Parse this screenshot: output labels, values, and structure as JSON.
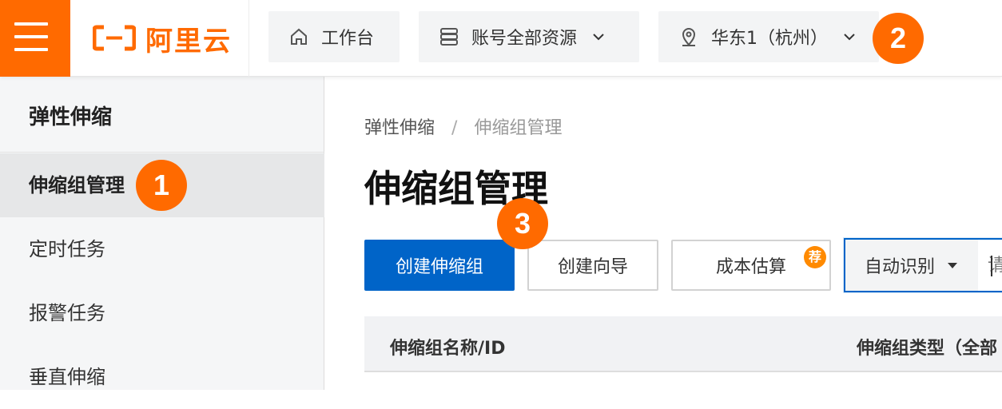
{
  "topbar": {
    "logo_text": "阿里云",
    "home_label": "工作台",
    "resources_label": "账号全部资源",
    "region_label": "华东1（杭州）"
  },
  "steps": [
    "1",
    "2",
    "3"
  ],
  "sidebar": {
    "title": "弹性伸缩",
    "items": [
      {
        "label": "伸缩组管理",
        "active": true
      },
      {
        "label": "定时任务"
      },
      {
        "label": "报警任务"
      },
      {
        "label": "垂直伸缩"
      }
    ]
  },
  "breadcrumb": {
    "root": "弹性伸缩",
    "separator": "/",
    "current": "伸缩组管理"
  },
  "page": {
    "title": "伸缩组管理"
  },
  "toolbar": {
    "create_label": "创建伸缩组",
    "wizard_label": "创建向导",
    "cost_label": "成本估算",
    "cost_badge": "荐",
    "search_mode": "自动识别",
    "search_placeholder": "请"
  },
  "table": {
    "columns": [
      "伸缩组名称/ID",
      "伸缩组类型（全部"
    ]
  },
  "colors": {
    "brand": "#ff6a00",
    "primary": "#0064c8"
  }
}
